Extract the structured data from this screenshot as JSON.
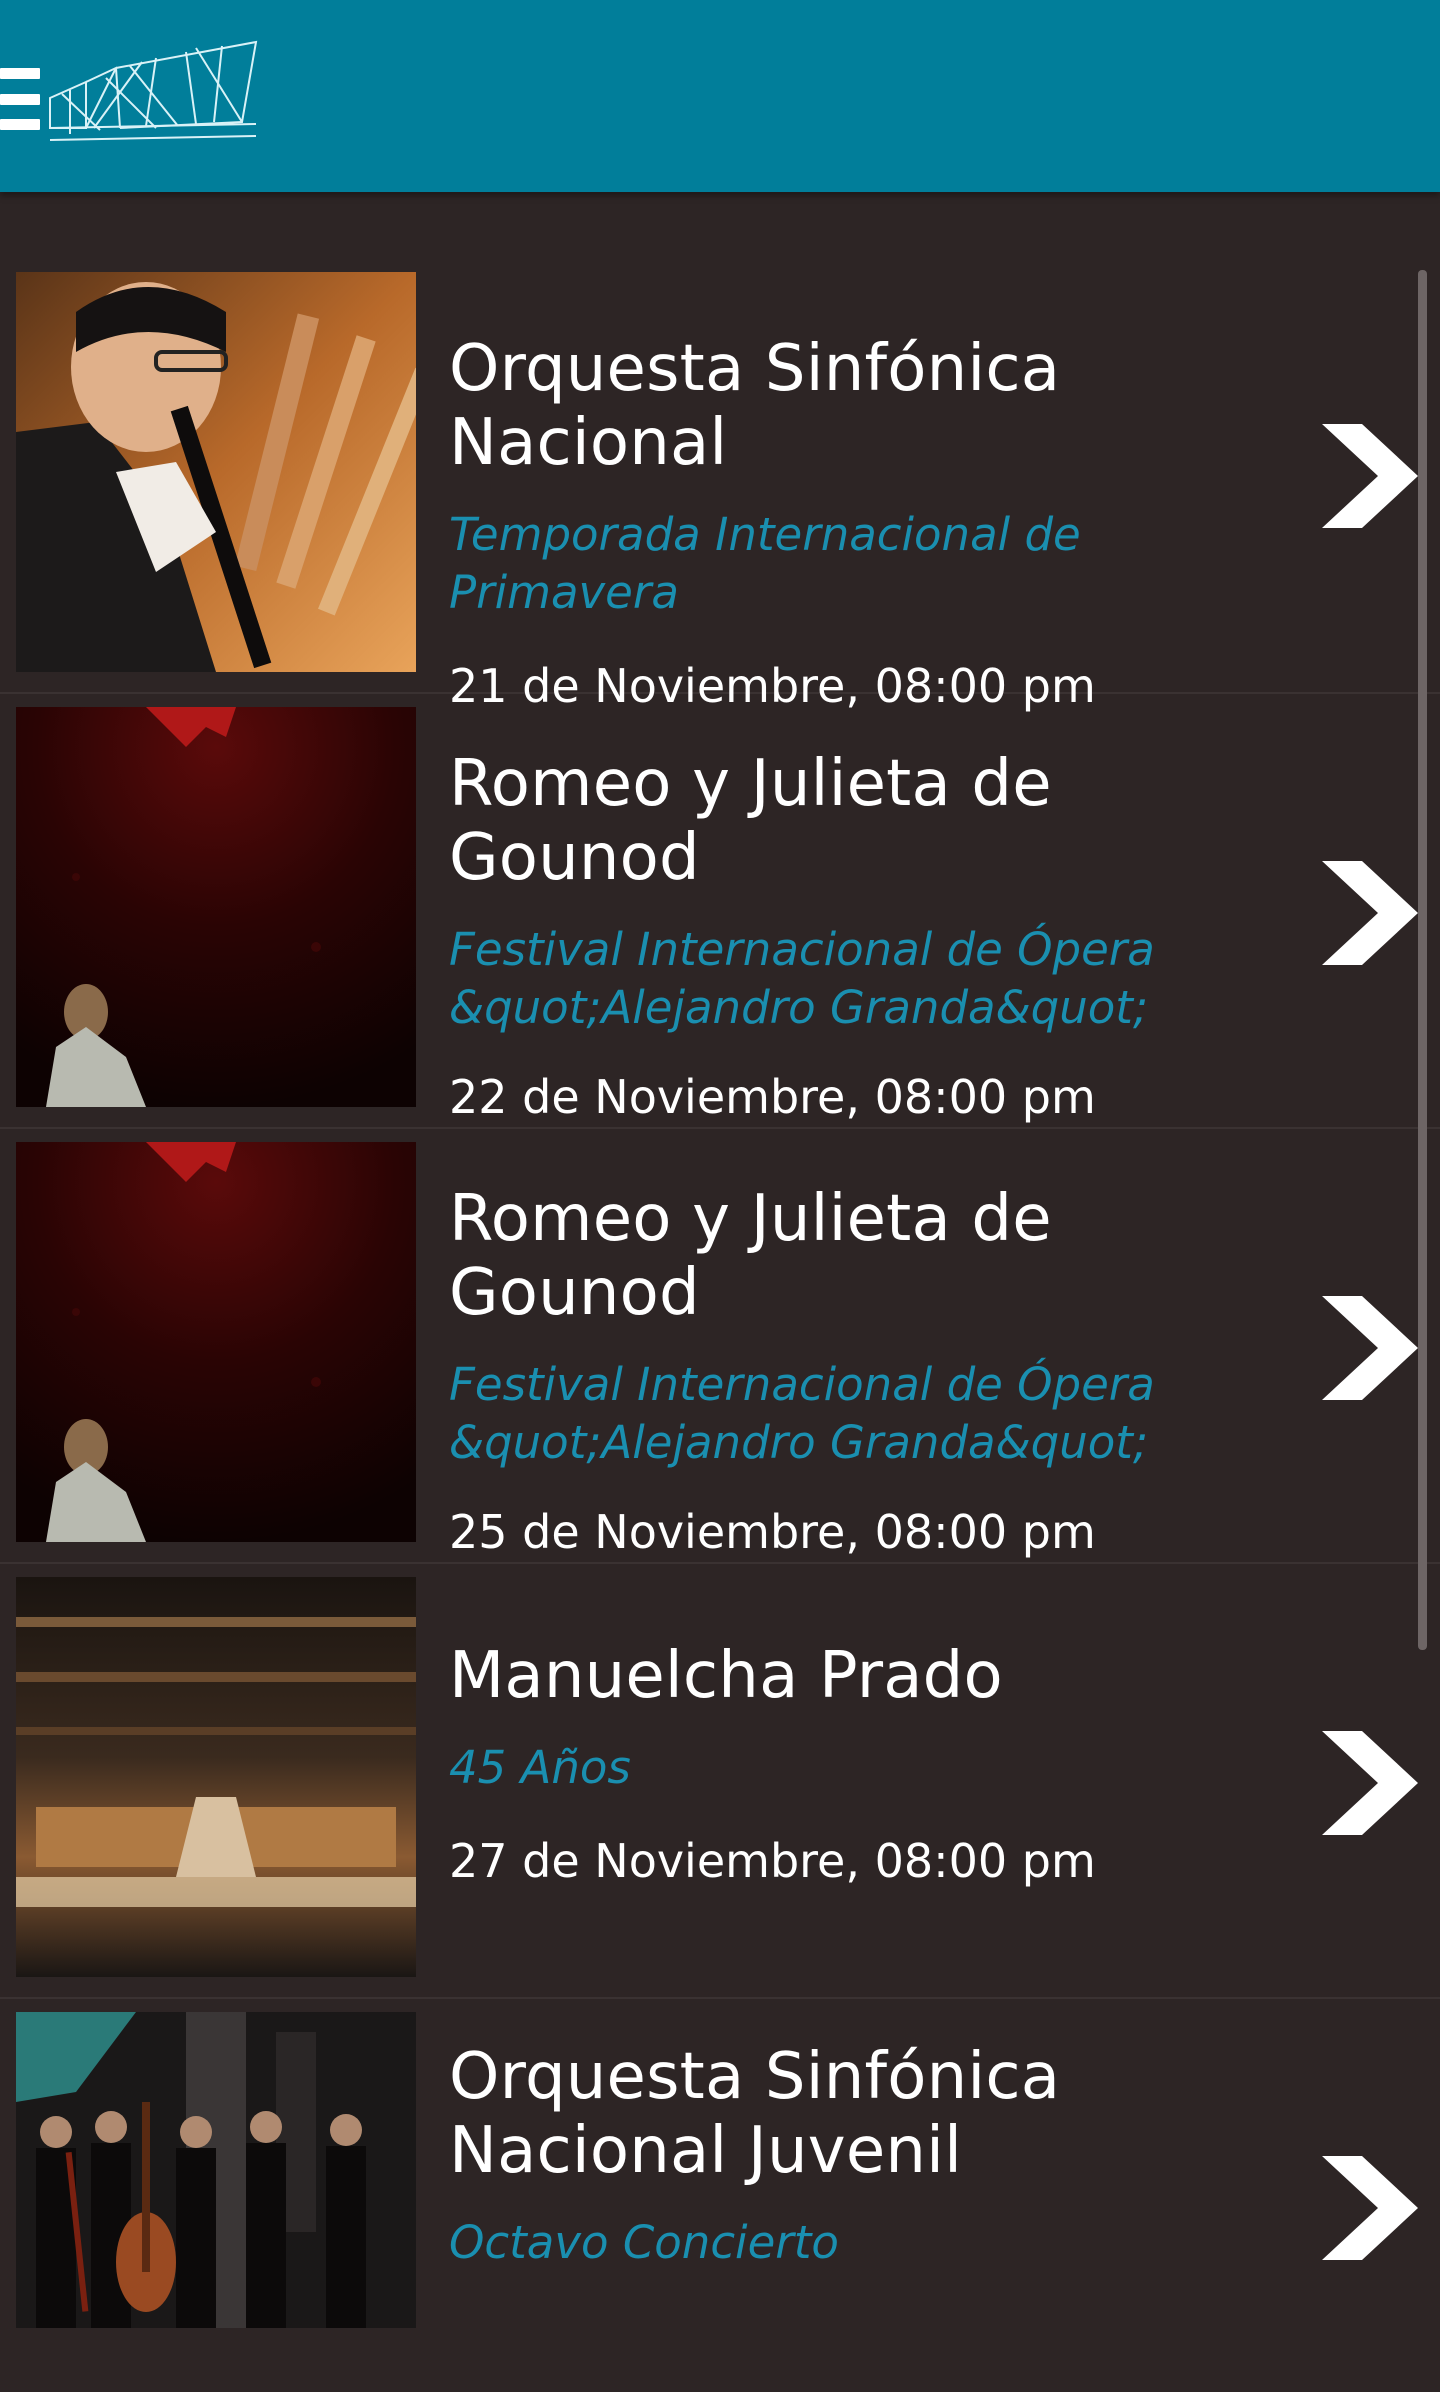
{
  "header": {
    "menu_icon": "hamburger-menu-icon",
    "logo_icon": "theater-building-logo-icon",
    "accent_color": "#017e9a"
  },
  "events": [
    {
      "title": "Orquesta Sinfónica Nacional",
      "subtitle": "Temporada Internacional de Primavera",
      "date": "21 de Noviembre, 08:00 pm",
      "image": "clarinet-musician-image",
      "chevron": "chevron-right-icon"
    },
    {
      "title": "Romeo y Julieta de Gounod",
      "subtitle": "Festival Internacional de Ópera &quot;Alejandro Granda&quot;",
      "date": "22 de Noviembre, 08:00 pm",
      "image": "opera-stage-image",
      "chevron": "chevron-right-icon"
    },
    {
      "title": "Romeo y Julieta de Gounod",
      "subtitle": "Festival Internacional de Ópera &quot;Alejandro Granda&quot;",
      "date": "25 de Noviembre, 08:00 pm",
      "image": "opera-stage-image",
      "chevron": "chevron-right-icon"
    },
    {
      "title": "Manuelcha Prado",
      "subtitle": "45 Años",
      "date": "27 de Noviembre, 08:00 pm",
      "image": "concert-hall-image",
      "chevron": "chevron-right-icon"
    },
    {
      "title": "Orquesta Sinfónica Nacional Juvenil",
      "subtitle": "Octavo Concierto",
      "date": "",
      "image": "youth-orchestra-image",
      "chevron": "chevron-right-icon"
    }
  ],
  "colors": {
    "background": "#2d2525",
    "title": "#ffffff",
    "subtitle": "#1a8fb0"
  }
}
